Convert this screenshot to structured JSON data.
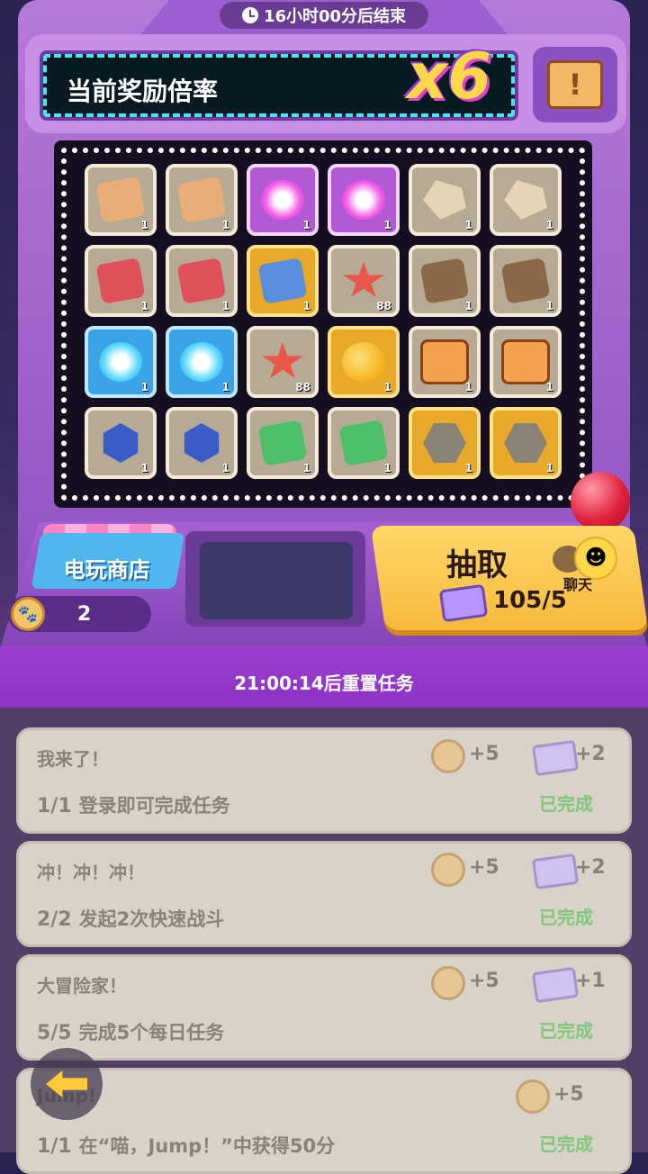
{
  "header": {
    "timer_text": "16小时00分后结束",
    "rate_label": "当前奖励倍率",
    "multiplier": "x6"
  },
  "grid": [
    [
      {
        "art": "ticket-tan",
        "qty": "1",
        "bg": "tan"
      },
      {
        "art": "ticket-tan",
        "qty": "1",
        "bg": "tan"
      },
      {
        "art": "orb-pink",
        "qty": "1",
        "bg": "purple"
      },
      {
        "art": "orb-pink",
        "qty": "1",
        "bg": "purple"
      },
      {
        "art": "crystal",
        "qty": "1",
        "bg": "tan"
      },
      {
        "art": "crystal",
        "qty": "1",
        "bg": "tan"
      }
    ],
    [
      {
        "art": "ticket-red",
        "qty": "1",
        "bg": "tan"
      },
      {
        "art": "ticket-red",
        "qty": "1",
        "bg": "tan"
      },
      {
        "art": "ticket-blue",
        "qty": "1",
        "bg": "gold"
      },
      {
        "art": "star-red",
        "qty": "88",
        "bg": "tan"
      },
      {
        "art": "ticket-brown",
        "qty": "1",
        "bg": "tan"
      },
      {
        "art": "ticket-brown",
        "qty": "1",
        "bg": "tan"
      }
    ],
    [
      {
        "art": "orb-blue",
        "qty": "1",
        "bg": "blue"
      },
      {
        "art": "orb-blue",
        "qty": "1",
        "bg": "blue"
      },
      {
        "art": "star-red",
        "qty": "88",
        "bg": "tan"
      },
      {
        "art": "fruit",
        "qty": "1",
        "bg": "gold"
      },
      {
        "art": "scroll",
        "qty": "1",
        "bg": "tan"
      },
      {
        "art": "scroll",
        "qty": "1",
        "bg": "tan"
      }
    ],
    [
      {
        "art": "gem-blue",
        "qty": "1",
        "bg": "tan"
      },
      {
        "art": "gem-blue",
        "qty": "1",
        "bg": "tan"
      },
      {
        "art": "ticket-green",
        "qty": "1",
        "bg": "tan"
      },
      {
        "art": "ticket-green",
        "qty": "1",
        "bg": "tan"
      },
      {
        "art": "fossil",
        "qty": "1",
        "bg": "gold"
      },
      {
        "art": "fossil",
        "qty": "1",
        "bg": "gold"
      }
    ]
  ],
  "shop": {
    "label": "电玩商店",
    "coins": "2"
  },
  "draw": {
    "label": "抽取",
    "count": "105/5"
  },
  "chat": {
    "label": "聊天"
  },
  "reset_text": "21:00:14后重置任务",
  "tasks": [
    {
      "title": "我来了！",
      "progress": "1/1",
      "desc": "登录即可完成任务",
      "coin_reward": "+5",
      "ticket_reward": "+2",
      "status": "已完成"
    },
    {
      "title": "冲！冲！冲！",
      "progress": "2/2",
      "desc": "发起2次快速战斗",
      "coin_reward": "+5",
      "ticket_reward": "+2",
      "status": "已完成"
    },
    {
      "title": "大冒险家！",
      "progress": "5/5",
      "desc": "完成5个每日任务",
      "coin_reward": "+5",
      "ticket_reward": "+1",
      "status": "已完成"
    },
    {
      "title": "Jump!",
      "progress": "1/1",
      "desc": "在“喵，Jump！”中获得50分",
      "coin_reward": "+5",
      "ticket_reward": "",
      "status": "已完成"
    }
  ]
}
